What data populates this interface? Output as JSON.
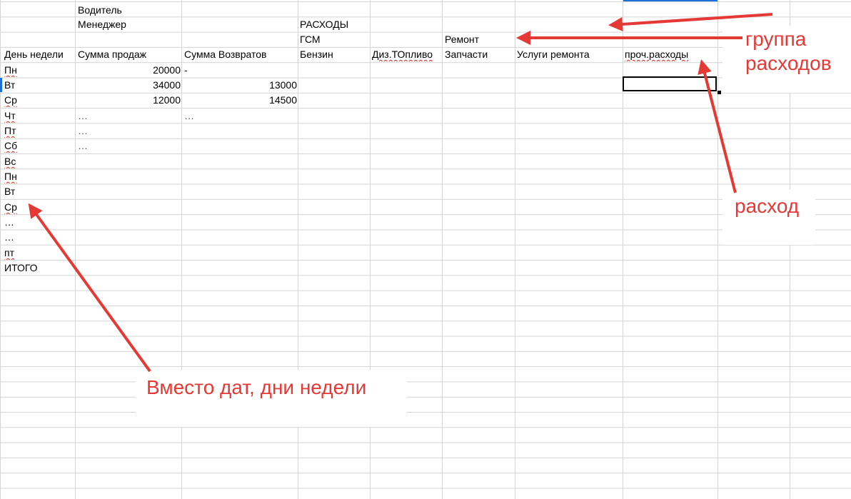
{
  "sheet": {
    "header_row1": {
      "driver": "Водитель"
    },
    "header_row2": {
      "manager": "Менеджер",
      "expenses": "РАСХОДЫ"
    },
    "header_row3": {
      "fuel_group": "ГСМ",
      "repair_group": "Ремонт"
    },
    "columns": {
      "day": "День недели",
      "sales": "Сумма продаж",
      "returns": "Сумма Возвратов",
      "petrol": "Бензин",
      "diesel": "Диз.ТОпливо",
      "parts": "Запчасти",
      "repair_services": "Услуги ремонта",
      "other": "проч.расходы"
    },
    "rows": [
      {
        "day": "Пн",
        "sales": "20000",
        "returns": "-"
      },
      {
        "day": "Вт",
        "sales": "34000",
        "returns": "13000"
      },
      {
        "day": "Ср",
        "sales": "12000",
        "returns": "14500"
      },
      {
        "day": "Чт",
        "sales": "…",
        "returns": "…"
      },
      {
        "day": "Пт",
        "sales": "…",
        "returns": ""
      },
      {
        "day": "Сб",
        "sales": "…",
        "returns": ""
      },
      {
        "day": "Вс",
        "sales": "",
        "returns": ""
      },
      {
        "day": "Пн",
        "sales": "",
        "returns": ""
      },
      {
        "day": "Вт",
        "sales": "",
        "returns": ""
      },
      {
        "day": "Ср",
        "sales": "",
        "returns": ""
      },
      {
        "day": "…",
        "sales": "",
        "returns": ""
      },
      {
        "day": "…",
        "sales": "",
        "returns": ""
      },
      {
        "day": "пт",
        "sales": "",
        "returns": ""
      },
      {
        "day": "ИТОГО",
        "sales": "",
        "returns": ""
      }
    ]
  },
  "annotations": {
    "expense_group_line1": "группа",
    "expense_group_line2": "расходов",
    "expense": "расход",
    "weekdays_note": "Вместо дат, дни недели"
  },
  "colors": {
    "annotation": "#e53935",
    "grid": "#d4d4d4",
    "selection_accent": "#1e6fd9"
  }
}
